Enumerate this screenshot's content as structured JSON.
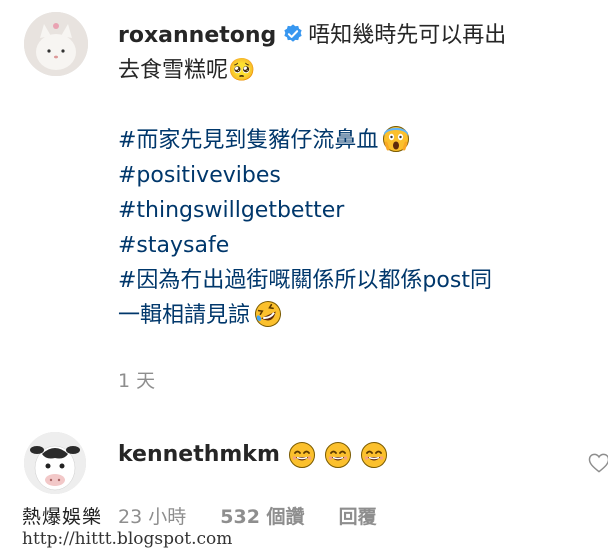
{
  "post": {
    "username": "roxannetong",
    "caption_lines": [
      "唔知幾時先可以再出",
      "去食雪糕呢🥺"
    ],
    "hashtag_lines": [
      "#而家先見到隻豬仔流鼻血",
      "#positivevibes",
      "#thingswillgetbetter",
      "#staysafe",
      "#因為冇出過街嘅關係所以都係post同",
      "一輯相請見諒"
    ],
    "timestamp": "1 天"
  },
  "comment": {
    "username": "kennethmkm",
    "time": "23 小時",
    "likes": "532 個讚",
    "reply": "回覆"
  },
  "icons": {
    "verified": "verified-badge-icon",
    "scream": "scream-emoji-icon",
    "laughing": "rolling-laughing-emoji-icon",
    "smiling": "smiling-emoji-icon",
    "heart": "heart-outline-icon"
  },
  "colors": {
    "hashtag": "#00376b",
    "verified": "#3897f0",
    "muted": "#8e8e8e"
  },
  "watermark": {
    "line1": "熱爆娛樂",
    "line2": "http://hittt.blogspot.com"
  }
}
